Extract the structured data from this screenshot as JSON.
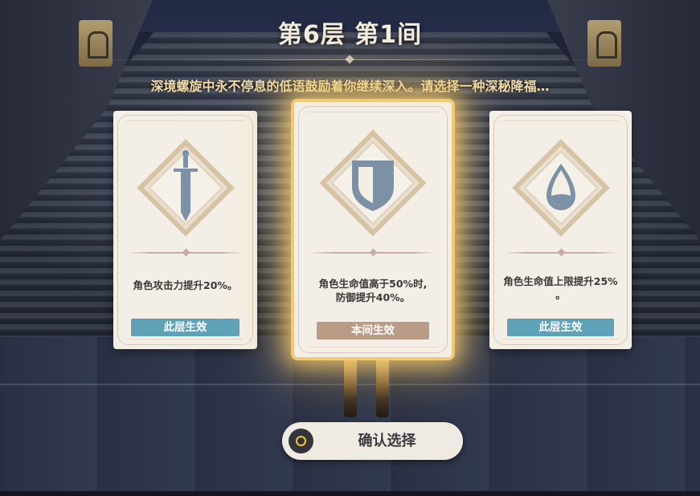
{
  "header": {
    "title": "第6层 第1间",
    "subtitle": "深境螺旋中永不停息的低语鼓励着你继续深入。请选择一种深秘降福…"
  },
  "cards": [
    {
      "icon": "sword-icon",
      "description_lines": [
        "角色攻击力提升20%。"
      ],
      "scope_label": "此层生效",
      "selected": false
    },
    {
      "icon": "shield-icon",
      "description_lines": [
        "角色生命值高于50%时,",
        "防御提升40%。"
      ],
      "scope_label": "本间生效",
      "selected": true
    },
    {
      "icon": "water-drop-icon",
      "description_lines": [
        "角色生命值上限提升25%",
        "。"
      ],
      "scope_label": "此层生效",
      "selected": false
    }
  ],
  "confirm": {
    "label": "确认选择"
  },
  "colors": {
    "title": "#f4ecdc",
    "subtitle": "#f2dca8",
    "card_bg": "#f4efe6",
    "layer_tag": "#5fa2b8",
    "room_tag": "#b99c86",
    "selected_glow": "#f1c873",
    "icon_fill": "#7d91a6"
  }
}
